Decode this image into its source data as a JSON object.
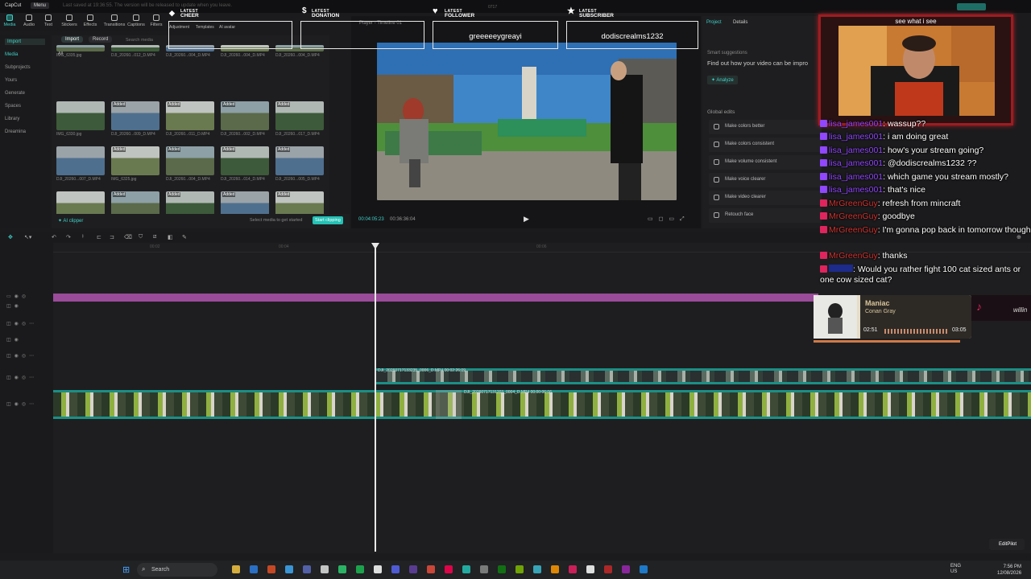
{
  "titlebar": {
    "app": "CapCut",
    "menu": "Menu",
    "notice": "Last saved at 19:36:55. The version will be released to update when you leave."
  },
  "toptabs": [
    {
      "label": "Media"
    },
    {
      "label": "Audio"
    },
    {
      "label": "Text"
    },
    {
      "label": "Stickers"
    },
    {
      "label": "Effects"
    },
    {
      "label": "Transitions"
    },
    {
      "label": "Captions"
    },
    {
      "label": "Filters"
    },
    {
      "label": "Adjustment"
    },
    {
      "label": "Templates"
    },
    {
      "label": "AI avatar"
    }
  ],
  "leftnav": [
    "Import",
    "Media",
    "Subprojects",
    "Yours",
    "Generate",
    "Spaces",
    "Library",
    "Dreamina"
  ],
  "media": {
    "import": "Import",
    "record": "Record",
    "search_placeholder": "Search media",
    "filter": "All",
    "added": "Added",
    "rows": [
      [
        "IMG_6335.jpg",
        "DJI_20260...012_D.MP4",
        "DJI_20260...004_D.MP4",
        "DJI_20260...004_D.MP4",
        "DJI_20260...004_D.MP4"
      ],
      [
        "IMG_6330.jpg",
        "DJI_20260...009_D.MP4",
        "DJI_20260...011_D.MP4",
        "DJI_20260...002_D.MP4",
        "DJI_20260...017_D.MP4"
      ],
      [
        "DJI_20260...007_D.MP4",
        "IMG_6325.jpg",
        "DJI_20260...004_D.MP4",
        "DJI_20260...014_D.MP4",
        "DJI_20260...005_D.MP4"
      ],
      [
        "DJI_20260...056_D.MP4",
        "DJI_20260...018_D.MP4",
        "DJI_20260...019_D.MP4",
        "IMG_6305-2.jpg",
        "IMG_6309.jpg"
      ]
    ],
    "durations": [
      "00:13",
      "00:18"
    ]
  },
  "mediafoot": {
    "clipper": "AI clipper",
    "hint": "Select media to get started",
    "button": "Start clipping"
  },
  "preview": {
    "player_title": "Player - Timeline 01",
    "time_current": "00:04:05:23",
    "time_total": "00:36:36:04",
    "counter": "0717"
  },
  "rightpanel": {
    "tabs": [
      "Project",
      "Details"
    ],
    "smart_title": "Smart suggestions",
    "smart_text": "Find out how your video can be impro",
    "analyze": "Analyze",
    "global_title": "Global edits",
    "items": [
      "Make colors better",
      "Make colors consistent",
      "Make volume consistent",
      "Make voice clearer",
      "Make video clearer",
      "Retouch face"
    ]
  },
  "overlays": [
    {
      "small": "LATEST",
      "big": "CHEER",
      "value": ""
    },
    {
      "small": "LATEST",
      "big": "DONATION",
      "value": ""
    },
    {
      "small": "LATEST",
      "big": "FOLLOWER",
      "value": "greeeeeygreayi"
    },
    {
      "small": "LATEST",
      "big": "SUBSCRIBER",
      "value": "dodiscrealms1232"
    }
  ],
  "timeline": {
    "ticks": [
      "00:02",
      "00:04",
      "00:06"
    ],
    "clip1": "DJI_20260717133235_0006_D.MP4  00:02:26:09",
    "clip2": "DJI_20260717131203_0004_D.MP4  00:00:06:06"
  },
  "webcam": {
    "caption": "see what i see"
  },
  "chat": [
    {
      "user": "lisa_james001",
      "platform": "twitch",
      "msg": "wassup??"
    },
    {
      "user": "lisa_james001",
      "platform": "twitch",
      "msg": "i am doing great"
    },
    {
      "user": "lisa_james001",
      "platform": "twitch",
      "msg": "how's your stream going?"
    },
    {
      "user": "lisa_james001",
      "platform": "twitch",
      "msg": "@dodiscrealms1232 ??"
    },
    {
      "user": "lisa_james001",
      "platform": "twitch",
      "msg": "which game you stream mostly?"
    },
    {
      "user": "lisa_james001",
      "platform": "twitch",
      "msg": "that's nice"
    },
    {
      "user": "MrGreenGuy",
      "platform": "tiktok",
      "msg": "refresh from mincraft"
    },
    {
      "user": "MrGreenGuy",
      "platform": "tiktok",
      "msg": "goodbye"
    },
    {
      "user": "MrGreenGuy",
      "platform": "tiktok",
      "msg": "I'm gonna pop back in tomorrow though"
    },
    {
      "user": "MrGreenGuy",
      "platform": "tiktok",
      "msg": "thanks"
    },
    {
      "user": "",
      "platform": "tiktok",
      "msg": "Would you rather fight 100 cat sized ants or one cow sized cat?"
    }
  ],
  "music": {
    "title": "Maniac",
    "artist": "Conan Gray",
    "elapsed": "02:51",
    "total": "03:05",
    "progress": 0.93
  },
  "tiktok_banner": "willin",
  "editpilot": "EditPilot",
  "taskbar": {
    "search": "Search",
    "lang": "ENG",
    "region": "US",
    "time": "7:56 PM",
    "date": "12/08/2026"
  },
  "colors": {
    "accent": "#3fd0c8",
    "twitch": "#9146ff",
    "tiktok_user": "#d1332f",
    "webcam_border": "#9e1c22",
    "track_purple": "#9a4b9a"
  }
}
